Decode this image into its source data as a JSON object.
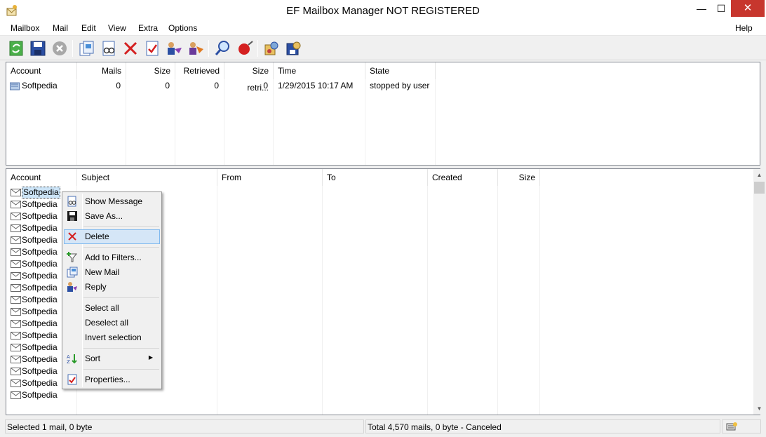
{
  "window": {
    "title": "EF Mailbox Manager NOT REGISTERED",
    "min_glyph": "—",
    "max_glyph": "☐",
    "close_glyph": "✕"
  },
  "menu": [
    "Mailbox",
    "Mail",
    "Edit",
    "View",
    "Extra",
    "Options",
    "Help"
  ],
  "toolbar_icons": [
    "refresh-icon",
    "save-icon",
    "stop-icon",
    "new-mail-icon",
    "show-message-icon",
    "delete-icon",
    "properties-icon",
    "reply-icon",
    "forward-icon",
    "search-icon",
    "filter-icon",
    "settings-icon",
    "accounts-icon"
  ],
  "accounts_table": {
    "headers": [
      "Account",
      "Mails",
      "Size",
      "Retrieved",
      "Size retri...",
      "Time",
      "State"
    ],
    "rows": [
      {
        "account": "Softpedia",
        "mails": "0",
        "size": "0",
        "retrieved": "0",
        "size_retrieved": "0",
        "time": "1/29/2015  10:17 AM",
        "state": "stopped by user"
      }
    ]
  },
  "mails_table": {
    "headers": [
      "Account",
      "Subject",
      "From",
      "To",
      "Created",
      "Size"
    ],
    "rows": [
      "Softpedia",
      "Softpedia",
      "Softpedia",
      "Softpedia",
      "Softpedia",
      "Softpedia",
      "Softpedia",
      "Softpedia",
      "Softpedia",
      "Softpedia",
      "Softpedia",
      "Softpedia",
      "Softpedia",
      "Softpedia",
      "Softpedia",
      "Softpedia",
      "Softpedia",
      "Softpedia"
    ]
  },
  "context_menu": {
    "items": [
      {
        "label": "Show Message",
        "icon": "show-message-icon"
      },
      {
        "label": "Save As...",
        "icon": "save-icon"
      },
      {
        "label": "Delete",
        "icon": "delete-icon",
        "highlighted": true
      },
      {
        "label": "Add to Filters...",
        "icon": "filter-add-icon"
      },
      {
        "label": "New Mail",
        "icon": "new-mail-icon"
      },
      {
        "label": "Reply",
        "icon": "reply-icon"
      },
      {
        "label": "Select all"
      },
      {
        "label": "Deselect all"
      },
      {
        "label": "Invert selection"
      },
      {
        "label": "Sort",
        "icon": "sort-icon",
        "submenu": true
      },
      {
        "label": "Properties...",
        "icon": "properties-icon"
      }
    ]
  },
  "status": {
    "left": "Selected 1 mail, 0 byte",
    "right": "Total 4,570 mails, 0 byte - Canceled",
    "icon": "connection-icon"
  },
  "colors": {
    "close_button": "#c7362d",
    "highlight": "#d5e6f7",
    "highlight_border": "#80b9ee"
  }
}
